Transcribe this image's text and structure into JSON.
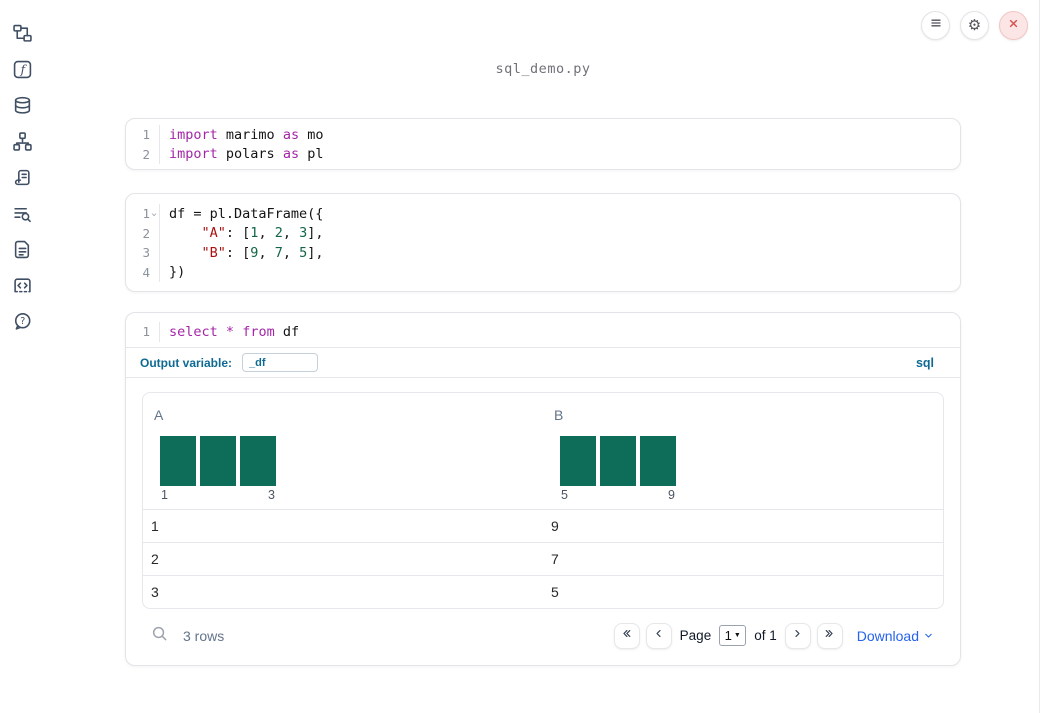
{
  "notebook": {
    "filename": "sql_demo.py"
  },
  "topbar": {
    "icons": [
      "hamburger-icon",
      "gear-icon",
      "close-icon"
    ]
  },
  "sidebar": {
    "icons": [
      "file-tree",
      "function-square",
      "database",
      "dependency-graph",
      "scroll",
      "list-search",
      "document",
      "code-snippet",
      "help"
    ]
  },
  "cells": [
    {
      "name": "imports-cell",
      "lines": [
        {
          "num": "1",
          "tokens": [
            [
              "import",
              "kw"
            ],
            [
              " marimo ",
              "pl"
            ],
            [
              "as",
              "kw"
            ],
            [
              " mo",
              "pl"
            ]
          ]
        },
        {
          "num": "2",
          "tokens": [
            [
              "import",
              "kw"
            ],
            [
              " polars ",
              "pl"
            ],
            [
              "as",
              "kw"
            ],
            [
              " pl",
              "pl"
            ]
          ]
        }
      ]
    },
    {
      "name": "dataframe-cell",
      "lines": [
        {
          "num": "1",
          "fold": true,
          "tokens": [
            [
              "df = pl.DataFrame({",
              "pl"
            ]
          ]
        },
        {
          "num": "2",
          "tokens": [
            [
              "    ",
              "pl"
            ],
            [
              "\"A\"",
              "str"
            ],
            [
              ": [",
              "pl"
            ],
            [
              "1",
              "num"
            ],
            [
              ", ",
              "pl"
            ],
            [
              "2",
              "num"
            ],
            [
              ", ",
              "pl"
            ],
            [
              "3",
              "num"
            ],
            [
              "],",
              "pl"
            ]
          ]
        },
        {
          "num": "3",
          "tokens": [
            [
              "    ",
              "pl"
            ],
            [
              "\"B\"",
              "str"
            ],
            [
              ": [",
              "pl"
            ],
            [
              "9",
              "num"
            ],
            [
              ", ",
              "pl"
            ],
            [
              "7",
              "num"
            ],
            [
              ", ",
              "pl"
            ],
            [
              "5",
              "num"
            ],
            [
              "],",
              "pl"
            ]
          ]
        },
        {
          "num": "4",
          "tokens": [
            [
              "})",
              "pl"
            ]
          ]
        }
      ]
    }
  ],
  "sql_cell": {
    "line": {
      "num": "1",
      "tokens": [
        [
          "select",
          "kw"
        ],
        [
          " ",
          "pl"
        ],
        [
          "*",
          "kw"
        ],
        [
          " ",
          "pl"
        ],
        [
          "from",
          "kw"
        ],
        [
          " df",
          "pl"
        ]
      ]
    },
    "output_variable_label": "Output variable:",
    "output_variable_value": "_df",
    "language_label": "sql"
  },
  "table": {
    "columns": [
      {
        "name": "A",
        "histogram": {
          "bars": [
            1,
            1,
            1
          ],
          "min_label": "1",
          "max_label": "3"
        }
      },
      {
        "name": "B",
        "histogram": {
          "bars": [
            1,
            1,
            1
          ],
          "min_label": "5",
          "max_label": "9"
        }
      }
    ],
    "rows": [
      [
        "1",
        "9"
      ],
      [
        "2",
        "7"
      ],
      [
        "3",
        "5"
      ]
    ],
    "row_count": "3 rows",
    "pagination": {
      "page_label": "Page",
      "current_page": "1",
      "of_label": "of 1"
    },
    "download_label": "Download"
  },
  "colors": {
    "keyword": "#a326a8",
    "string": "#aa1111",
    "number": "#116644",
    "histogram_bar": "#0e6d58",
    "accent_blue": "#0f6a93",
    "link_blue": "#2563eb",
    "close_red": "#d64f4f"
  }
}
